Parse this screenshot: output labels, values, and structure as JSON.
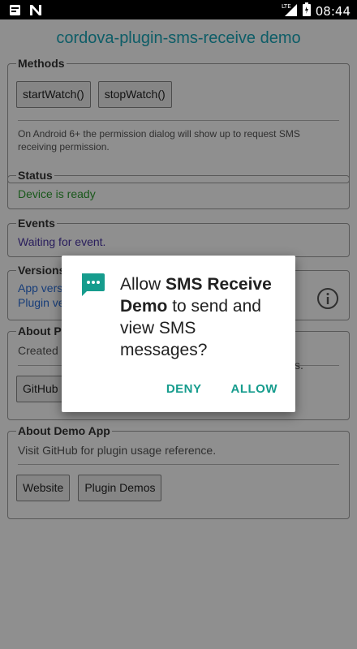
{
  "app_title": "cordova-plugin-sms-receive demo",
  "status_bar": {
    "time": "08:44",
    "network": "LTE"
  },
  "methods": {
    "legend": "Methods",
    "buttons": [
      "startWatch()",
      "stopWatch()"
    ],
    "note": "On Android 6+ the permission dialog will show up to request SMS receiving permission."
  },
  "status": {
    "legend": "Status",
    "text": "Device is ready"
  },
  "events": {
    "legend": "Events",
    "text": "Waiting for event."
  },
  "versions": {
    "legend": "Versions",
    "line1": "App vers",
    "line2": "Plugin ve"
  },
  "about_plugin": {
    "legend": "About Pl",
    "text": "Created b",
    "text_tail": "s.",
    "button": "GitHub"
  },
  "about_demo": {
    "legend": "About Demo App",
    "text": "Visit GitHub for plugin usage reference.",
    "buttons": [
      "Website",
      "Plugin Demos"
    ]
  },
  "dialog": {
    "prefix": "Allow ",
    "app_name": "SMS Receive Demo",
    "suffix": " to send and view SMS messages?",
    "deny": "DENY",
    "allow": "ALLOW"
  },
  "colors": {
    "accent": "#169c8d",
    "title": "#1aa7b8",
    "status_ok": "#2e9d30",
    "event": "#4a35a5"
  }
}
